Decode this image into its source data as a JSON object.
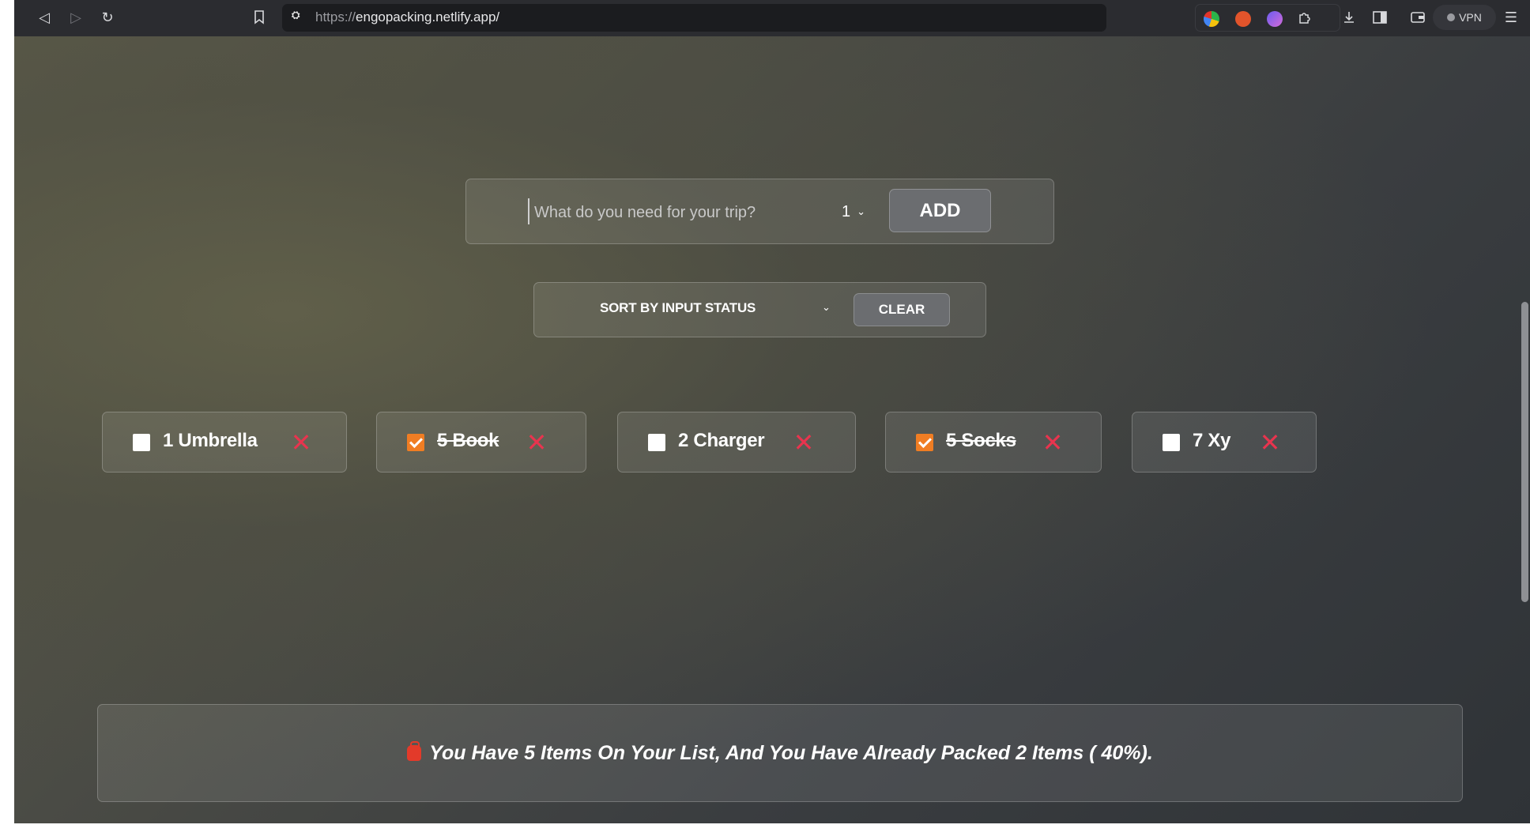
{
  "browser": {
    "url_scheme": "https://",
    "url_host": "engopacking.netlify.app/",
    "vpn_label": "VPN",
    "icons": {
      "back": "back-arrow-icon",
      "forward": "forward-arrow-icon",
      "reload": "reload-icon",
      "bookmark": "bookmark-icon",
      "site": "site-info-icon",
      "download": "download-icon",
      "sidebar": "sidebar-icon",
      "wallet": "wallet-icon",
      "menu": "menu-icon"
    }
  },
  "form": {
    "placeholder": "What do you need for your trip?",
    "input_value": "",
    "quantity": "1",
    "add_label": "ADD"
  },
  "actions": {
    "sort_label": "SORT BY INPUT STATUS",
    "clear_label": "CLEAR"
  },
  "items": [
    {
      "label": "1 Umbrella",
      "packed": false
    },
    {
      "label": "5 Book",
      "packed": true
    },
    {
      "label": "2 Charger",
      "packed": false
    },
    {
      "label": "5 Socks",
      "packed": true
    },
    {
      "label": "7 Xy",
      "packed": false
    }
  ],
  "stats": {
    "text": "You Have 5 Items On Your List, And You Have Already Packed 2 Items ( 40%)."
  },
  "colors": {
    "accent_checkbox": "#f07d23",
    "delete": "#e8344e"
  }
}
